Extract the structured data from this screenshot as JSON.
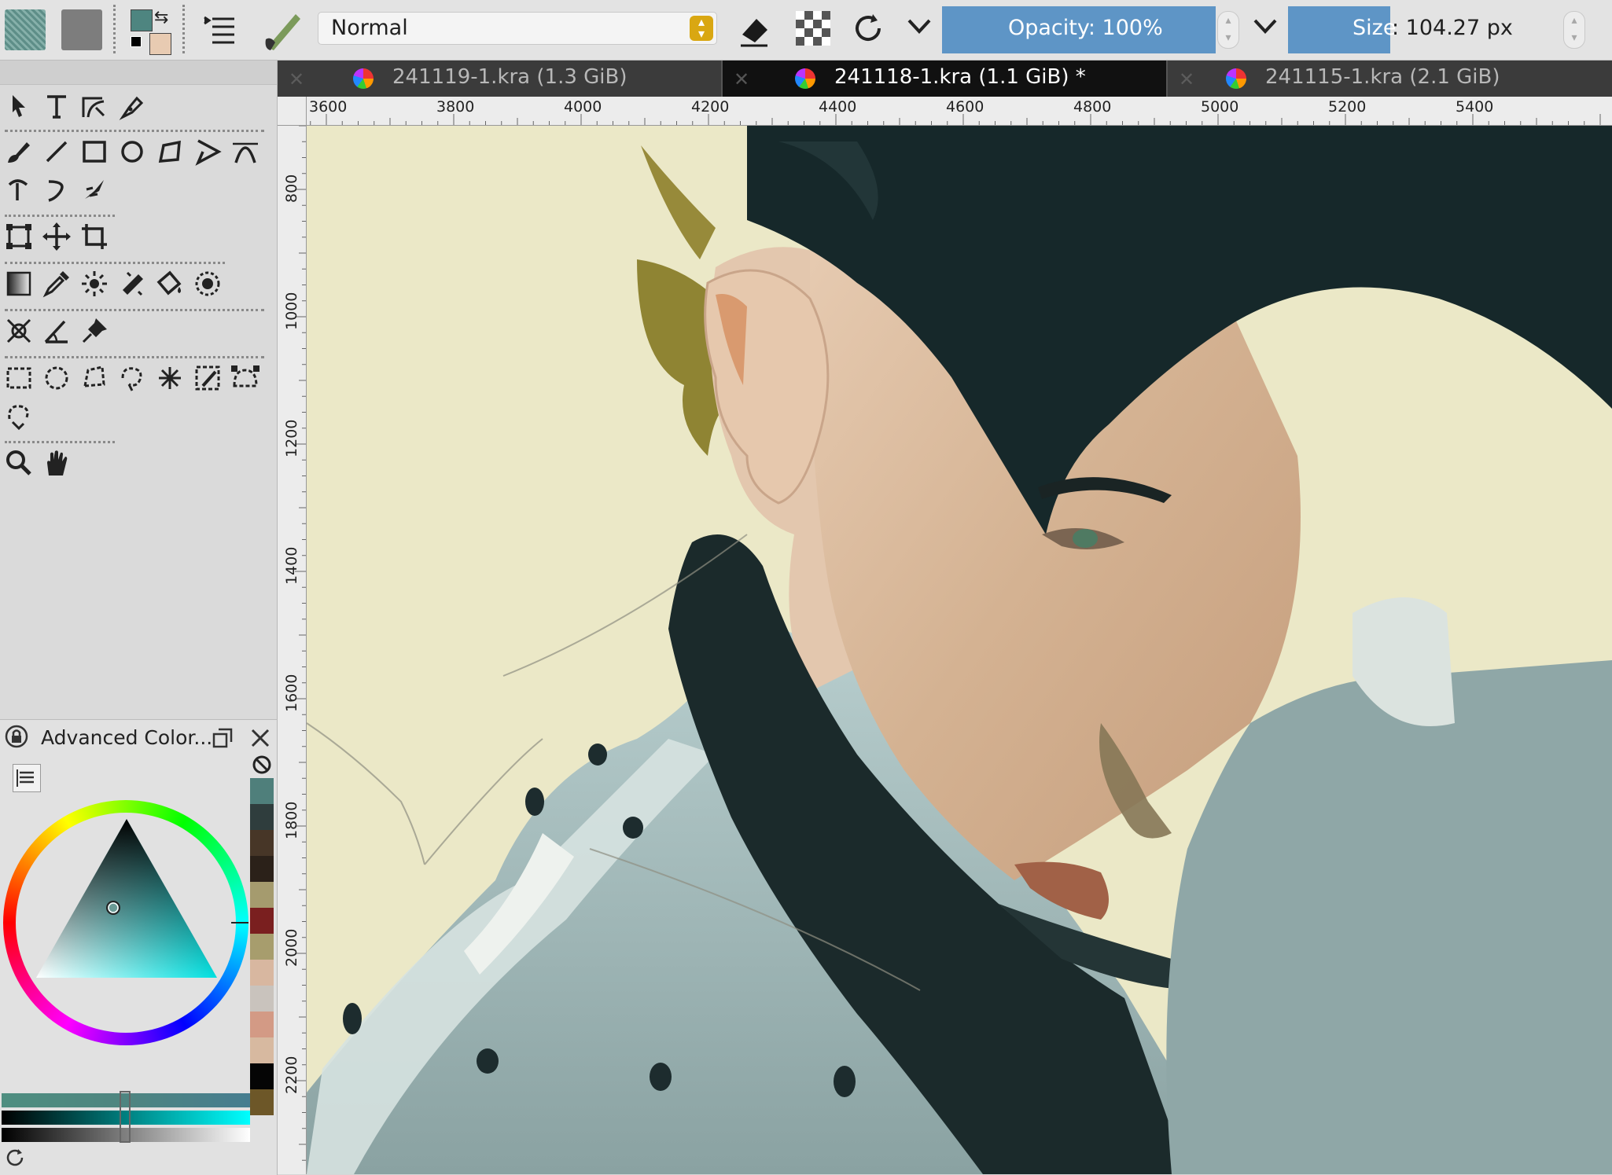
{
  "toolbar": {
    "blend_mode": "Normal",
    "opacity_label": "Opacity: 100%",
    "size_prefix": "Size",
    "size_value": ": 104.27 px",
    "opacity_percent": 100
  },
  "tabs": [
    {
      "label": "241119-1.kra (1.3 GiB)",
      "active": false
    },
    {
      "label": "241118-1.kra (1.1 GiB) *",
      "active": true
    },
    {
      "label": "241115-1.kra (2.1 GiB)",
      "active": false
    }
  ],
  "ruler": {
    "h_labels": [
      "3600",
      "3800",
      "4000",
      "4200",
      "4400",
      "4600",
      "4800",
      "5000",
      "5200",
      "5400"
    ],
    "v_labels": [
      "800",
      "1000",
      "1200",
      "1400",
      "1600",
      "1800",
      "2000",
      "2200"
    ]
  },
  "color_panel": {
    "title": "Advanced Color...",
    "swatches": [
      "#4f7f7b",
      "#2f3d3d",
      "#473627",
      "#2b2119",
      "#a59b6e",
      "#7a1f1f",
      "#a79d6d",
      "#d8b7a0",
      "#c9c3bd",
      "#d39a85",
      "#d7b9a0",
      "#050505",
      "#6d5728"
    ]
  },
  "colors": {
    "foreground": "#4e8580",
    "background": "#e8cbb2",
    "accent": "#5e95c6",
    "canvas_bg": "#ebe8c7"
  }
}
